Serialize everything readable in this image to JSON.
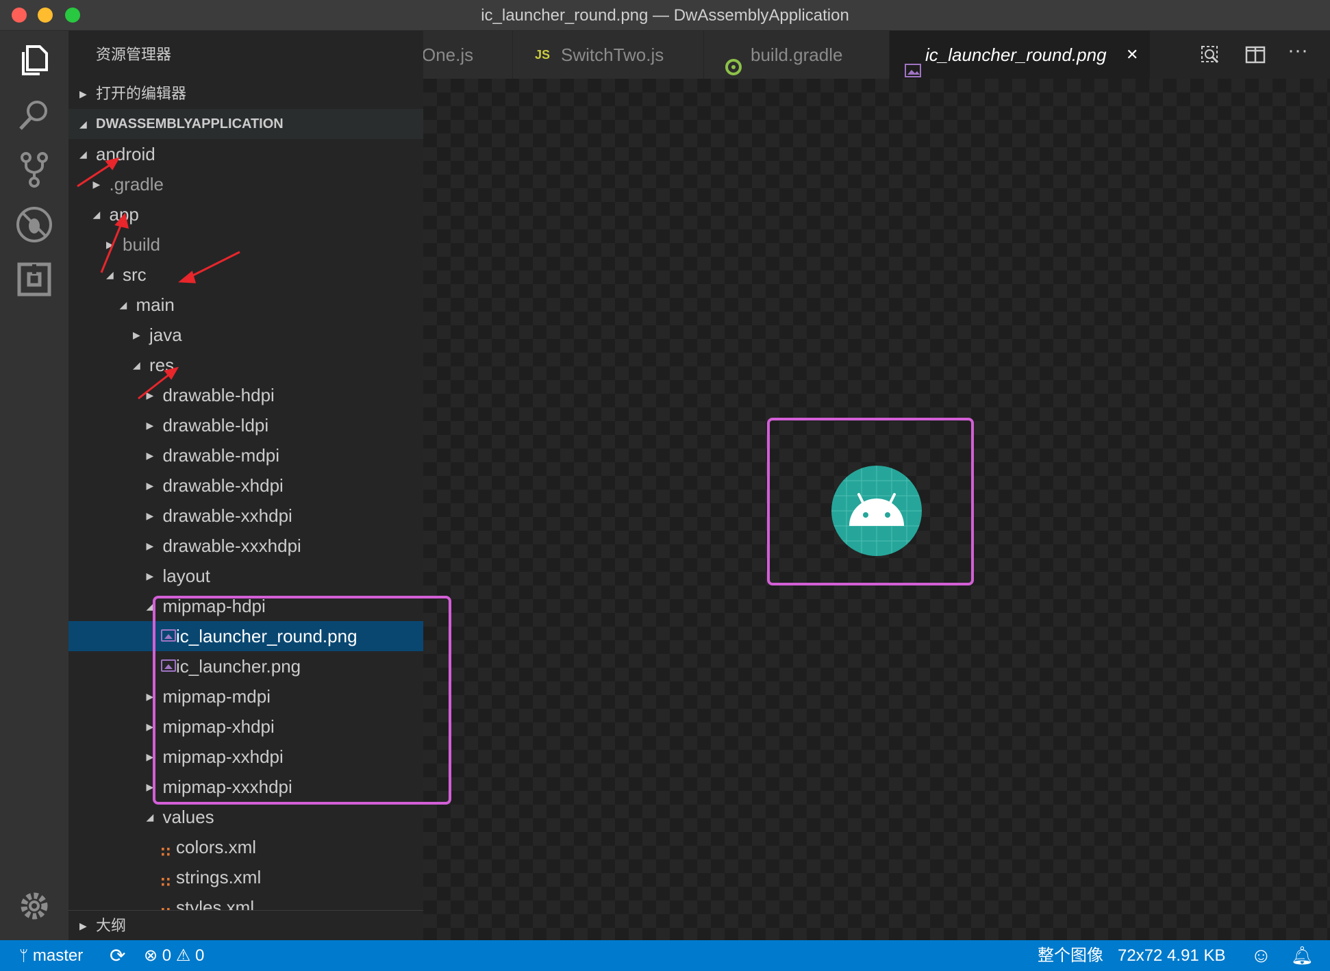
{
  "window": {
    "title": "ic_launcher_round.png — DwAssemblyApplication"
  },
  "activity_bar": {
    "items": [
      "explorer-icon",
      "search-icon",
      "source-control-icon",
      "debug-icon",
      "extensions-icon"
    ],
    "bottom": "gear-icon"
  },
  "sidebar": {
    "title": "资源管理器",
    "open_editors_label": "打开的编辑器",
    "project_label": "DWASSEMBLYAPPLICATION",
    "outline_label": "大纲",
    "tree": [
      {
        "name": "android",
        "expanded": true
      },
      {
        "name": ".gradle",
        "expanded": false
      },
      {
        "name": "app",
        "expanded": true
      },
      {
        "name": "build",
        "expanded": false
      },
      {
        "name": "src",
        "expanded": true
      },
      {
        "name": "main",
        "expanded": true
      },
      {
        "name": "java",
        "expanded": false
      },
      {
        "name": "res",
        "expanded": true
      },
      {
        "name": "drawable-hdpi",
        "expanded": false
      },
      {
        "name": "drawable-ldpi",
        "expanded": false
      },
      {
        "name": "drawable-mdpi",
        "expanded": false
      },
      {
        "name": "drawable-xhdpi",
        "expanded": false
      },
      {
        "name": "drawable-xxhdpi",
        "expanded": false
      },
      {
        "name": "drawable-xxxhdpi",
        "expanded": false
      },
      {
        "name": "layout",
        "expanded": false
      },
      {
        "name": "mipmap-hdpi",
        "expanded": true
      },
      {
        "name": "ic_launcher_round.png",
        "type": "image"
      },
      {
        "name": "ic_launcher.png",
        "type": "image"
      },
      {
        "name": "mipmap-mdpi",
        "expanded": false
      },
      {
        "name": "mipmap-xhdpi",
        "expanded": false
      },
      {
        "name": "mipmap-xxhdpi",
        "expanded": false
      },
      {
        "name": "mipmap-xxxhdpi",
        "expanded": false
      },
      {
        "name": "values",
        "expanded": true
      },
      {
        "name": "colors.xml",
        "type": "xml"
      },
      {
        "name": "strings.xml",
        "type": "xml"
      },
      {
        "name": "styles.xml",
        "type": "xml"
      }
    ]
  },
  "tabs": [
    {
      "label": "One.js",
      "icon": "js-icon"
    },
    {
      "label": "SwitchTwo.js",
      "icon_text": "JS"
    },
    {
      "label": "build.gradle",
      "icon": "gradle-icon"
    },
    {
      "label": "ic_launcher_round.png",
      "icon": "image-file-icon",
      "active": true,
      "close": "✕"
    }
  ],
  "statusbar": {
    "branch": "master",
    "errors": "0",
    "warnings": "0",
    "view_mode": "整个图像",
    "image_info": "72x72 4.91 KB"
  },
  "colors": {
    "accent": "#007acc",
    "selection": "#094771",
    "annotation_box": "#d35fd6",
    "annotation_arrow": "#e8262b",
    "android_teal": "#26a69a"
  }
}
